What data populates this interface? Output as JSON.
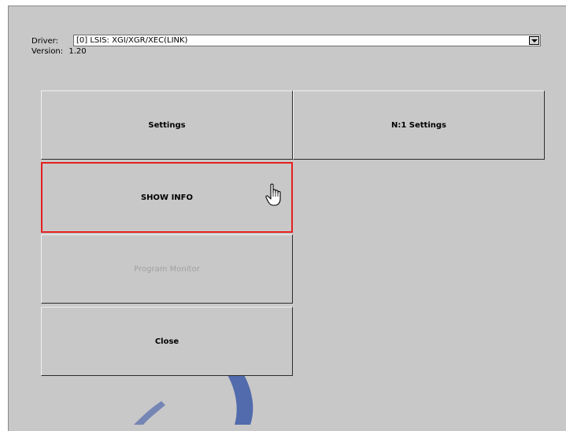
{
  "driver": {
    "label": "Driver:",
    "value": "[0] LSIS: XGI/XGR/XEC(LINK)"
  },
  "version": {
    "label": "Version:",
    "value": "1.20"
  },
  "buttons": {
    "settings": "Settings",
    "n1_settings": "N:1 Settings",
    "show_info": "SHOW INFO",
    "program_monitor": "Program Monitor",
    "close": "Close"
  },
  "colors": {
    "selection": "#e52020",
    "background": "#c8c8c8",
    "disabled_text": "#a0a0a0"
  },
  "icons": {
    "cursor": "hand-pointer-icon",
    "dropdown": "chevron-down-icon"
  }
}
